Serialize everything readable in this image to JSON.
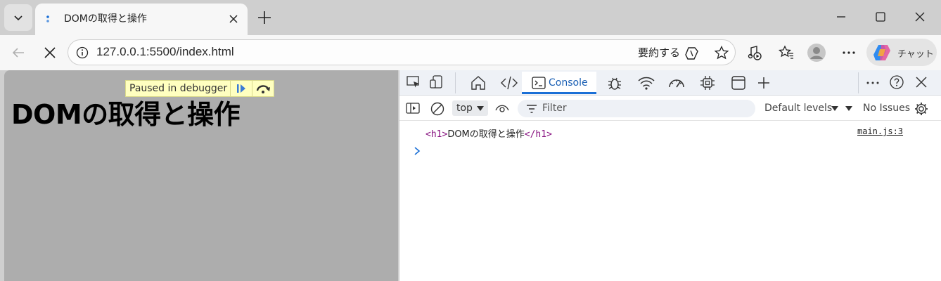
{
  "browser": {
    "tab": {
      "title": "DOMの取得と操作"
    },
    "address": {
      "url": "127.0.0.1:5500/index.html"
    },
    "summarize_label": "要約する",
    "copilot_label": "チャット"
  },
  "page": {
    "heading": "DOMの取得と操作",
    "debugger_banner": "Paused in debugger"
  },
  "devtools": {
    "active_tab": "Console",
    "context": "top",
    "filter_placeholder": "Filter",
    "levels_label": "Default levels",
    "issues_label": "No Issues",
    "log": {
      "open_tag": "<h1>",
      "text": "DOMの取得と操作",
      "close_tag": "</h1>",
      "source": "main.js:3"
    }
  },
  "colors": {
    "accent": "#1a6fd6",
    "page_overlay": "#adadad",
    "debugger_banner": "#ffffc0",
    "tag": "#881280"
  }
}
